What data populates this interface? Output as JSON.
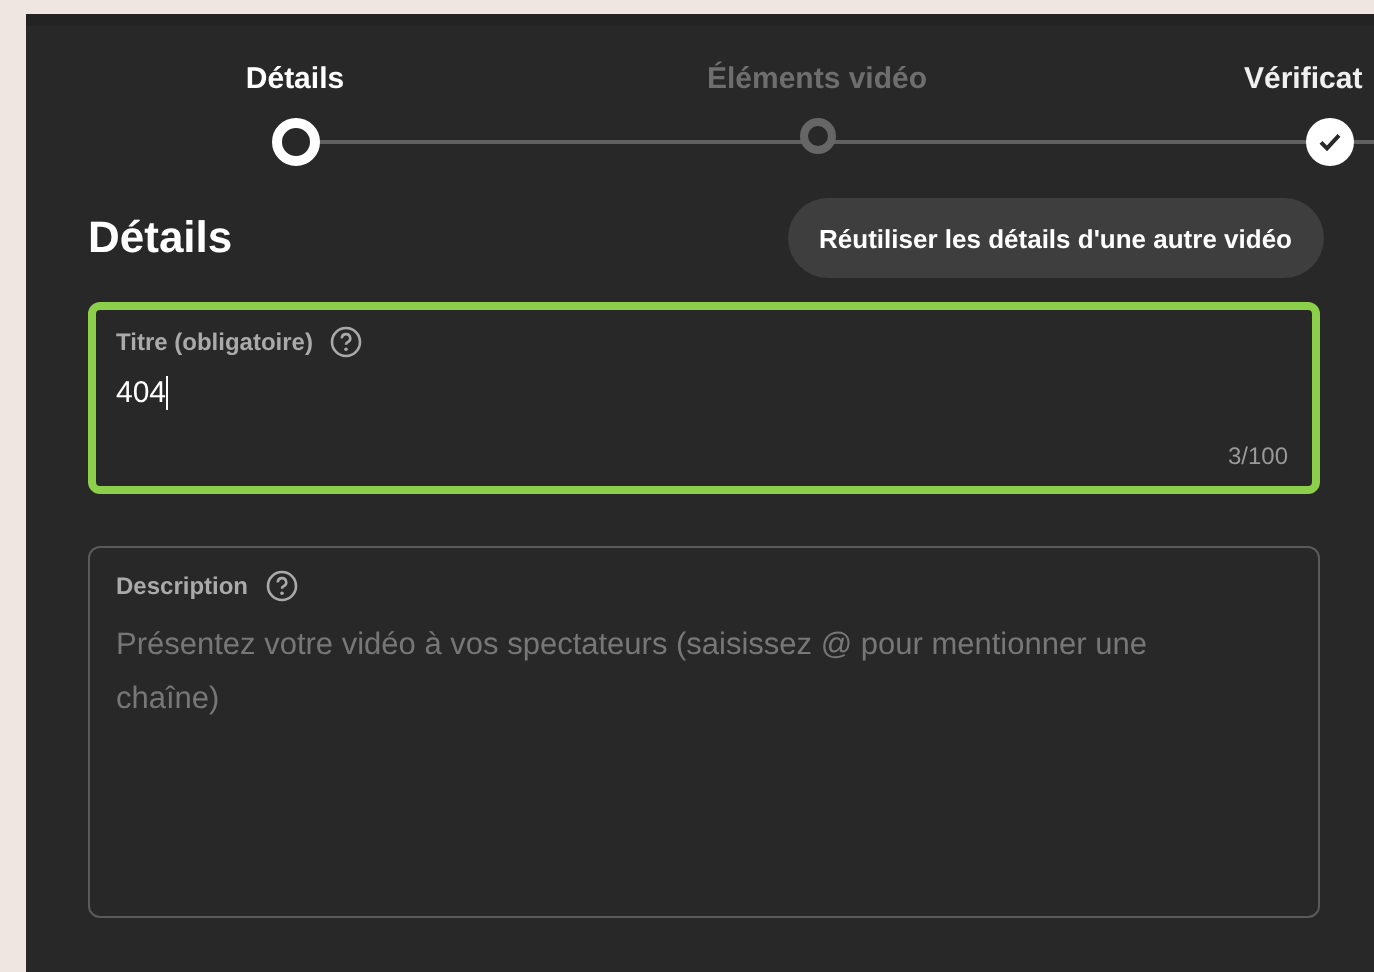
{
  "stepper": {
    "steps": [
      {
        "label": "Détails",
        "selected": true,
        "completed": false
      },
      {
        "label": "Éléments vidéo",
        "selected": false,
        "completed": false
      },
      {
        "label": "Vérificat",
        "selected": false,
        "completed": true
      }
    ]
  },
  "heading": "Détails",
  "reuse_button": "Réutiliser les détails d'une autre vidéo",
  "title_field": {
    "label": "Titre (obligatoire)",
    "value": "404",
    "counter": "3/100",
    "focused": true
  },
  "description_field": {
    "label": "Description",
    "placeholder": "Présentez votre vidéo à vos spectateurs (saisissez @ pour mentionner une chaîne)",
    "focused": false
  }
}
